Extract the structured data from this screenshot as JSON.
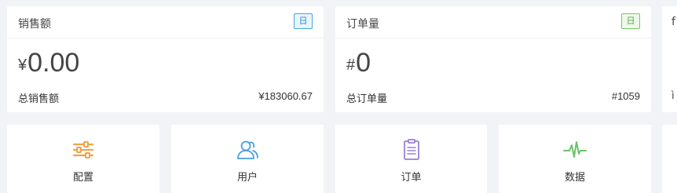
{
  "cards": [
    {
      "title": "销售额",
      "badge": "日",
      "currency_symbol": "¥",
      "value": "0.00",
      "footer_label": "总销售额",
      "footer_value": "¥183060.67"
    },
    {
      "title": "订单量",
      "badge": "日",
      "currency_symbol": "#",
      "value": "0",
      "footer_label": "总订单量",
      "footer_value": "#1059"
    }
  ],
  "partial_card": {
    "title_glyph": "f",
    "footer_glyph": "ì"
  },
  "tiles": [
    {
      "label": "配置",
      "icon": "sliders-icon",
      "color": "#f0a34a"
    },
    {
      "label": "用户",
      "icon": "users-icon",
      "color": "#4a9ee0"
    },
    {
      "label": "订单",
      "icon": "clipboard-icon",
      "color": "#9b7fd4"
    },
    {
      "label": "数据",
      "icon": "pulse-icon",
      "color": "#6cc26a"
    }
  ]
}
